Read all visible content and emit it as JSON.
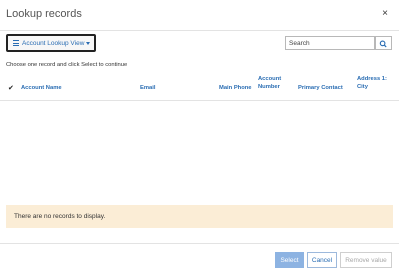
{
  "dialog": {
    "title": "Lookup records",
    "close_icon": "close-icon",
    "close_glyph": "×"
  },
  "toolbar": {
    "view_label": "Account Lookup View",
    "view_icon": "list-icon",
    "search_placeholder": "Search",
    "search_icon": "search-icon"
  },
  "instructions": "Choose one record and click Select to continue",
  "table": {
    "check_glyph": "✔",
    "columns": [
      "Account Name",
      "Email",
      "Main Phone",
      "Account Number",
      "Primary Contact",
      "Address 1: City"
    ],
    "rows": [],
    "empty_message": "There are no records to display."
  },
  "footer": {
    "select_label": "Select",
    "cancel_label": "Cancel",
    "remove_label": "Remove value"
  },
  "colors": {
    "accent": "#2a6db3",
    "primary_button": "#8db3e2",
    "empty_banner": "#fbedd6"
  }
}
